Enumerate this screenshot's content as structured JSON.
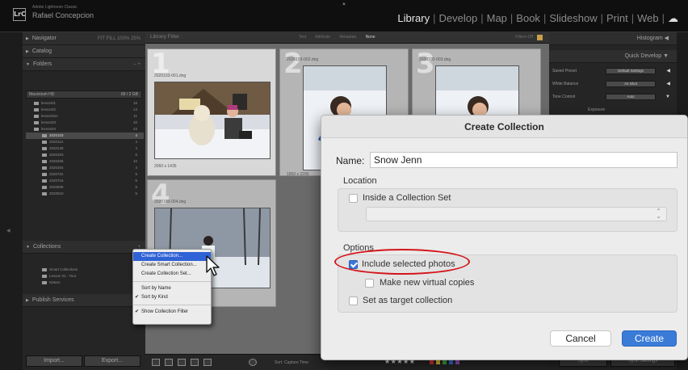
{
  "topbar": {
    "badge": "LrC",
    "app_name": "Adobe Lightroom Classic",
    "user_name": "Rafael Concepcion",
    "modules": [
      "Library",
      "Develop",
      "Map",
      "Book",
      "Slideshow",
      "Print",
      "Web"
    ],
    "active_module": "Library"
  },
  "left_panel": {
    "navigator": "Navigator",
    "navigator_zoom": "FIT  FILL  100%  25%",
    "catalog": "Catalog",
    "folders": "Folders",
    "folders_action": "–  +",
    "volume": "Macintosh HD",
    "volume_info": "69 / 2 GB",
    "folder_rows": [
      {
        "name": "lesson01",
        "count": "16"
      },
      {
        "name": "lesson02",
        "count": "13"
      },
      {
        "name": "lesson02A",
        "count": "11"
      },
      {
        "name": "lesson03",
        "count": "20"
      },
      {
        "name": "lesson04",
        "count": "42"
      },
      {
        "name": "2020103",
        "count": "4"
      },
      {
        "name": "2020113",
        "count": "4"
      },
      {
        "name": "2020148",
        "count": "4"
      },
      {
        "name": "2020203",
        "count": "6"
      },
      {
        "name": "2020206",
        "count": "10"
      },
      {
        "name": "2020304",
        "count": "4"
      },
      {
        "name": "2020704",
        "count": "5"
      },
      {
        "name": "2020716",
        "count": "5"
      },
      {
        "name": "2020808",
        "count": "5"
      },
      {
        "name": "2020810",
        "count": "5"
      }
    ],
    "collections": "Collections",
    "collections_action": "+",
    "collection_rows": [
      {
        "name": "Smart Collections"
      },
      {
        "name": "Lesson 01 - Tour"
      },
      {
        "name": "Nature"
      }
    ],
    "publish_services": "Publish Services",
    "import_label": "Import...",
    "export_label": "Export..."
  },
  "filter_bar": {
    "title": "Library Filter :",
    "tabs": [
      "Text",
      "Attribute",
      "Metadata",
      "None"
    ],
    "active_tab": "None",
    "custom_filter": "Filters Off"
  },
  "grid": {
    "cells": [
      {
        "num": "1",
        "filename": "2020103-001.dng",
        "dims": "2060 x 1435"
      },
      {
        "num": "2",
        "filename": "2020103-002.dng",
        "dims": "1860 x 2295"
      },
      {
        "num": "3",
        "filename": "2020103-003.dng",
        "dims": ""
      },
      {
        "num": "4",
        "filename": "2020103-004.dng",
        "dims": ""
      }
    ]
  },
  "toolbar": {
    "sort_label": "Sort:  Capture Time",
    "stars": "★★★★★",
    "swatch_colors": [
      "#d33",
      "#e8c22c",
      "#3fa93f",
      "#3a6ed8",
      "#9a4fc0"
    ]
  },
  "right_panel": {
    "histogram": "Histogram",
    "quick_develop": "Quick Develop",
    "saved_preset_label": "Saved Preset",
    "saved_preset_value": "Default Settings",
    "white_balance_label": "White Balance",
    "white_balance_value": "As Shot",
    "tone_control_label": "Tone Control",
    "tone_control_value": "Auto",
    "exposure_label": "Exposure",
    "sync_label": "Sync",
    "sync_settings_label": "Sync Settings"
  },
  "context_menu": {
    "items": [
      {
        "label": "Create Collection...",
        "highlighted": true
      },
      {
        "label": "Create Smart Collection..."
      },
      {
        "label": "Create Collection Set..."
      }
    ],
    "sort_items": [
      {
        "label": "Sort by Name",
        "checked": false
      },
      {
        "label": "Sort by Kind",
        "checked": true
      }
    ],
    "filter_item": {
      "label": "Show Collection Filter",
      "checked": true
    }
  },
  "dialog": {
    "title": "Create Collection",
    "name_label": "Name:",
    "name_value": "Snow Jenn",
    "location_label": "Location",
    "inside_set_label": "Inside a Collection Set",
    "inside_set_checked": false,
    "options_label": "Options",
    "include_selected_label": "Include selected photos",
    "include_selected_checked": true,
    "virtual_copies_label": "Make new virtual copies",
    "virtual_copies_checked": false,
    "target_label": "Set as target collection",
    "target_checked": false,
    "cancel_label": "Cancel",
    "create_label": "Create"
  },
  "annotation": {
    "highlight_color": "#d4141a"
  }
}
